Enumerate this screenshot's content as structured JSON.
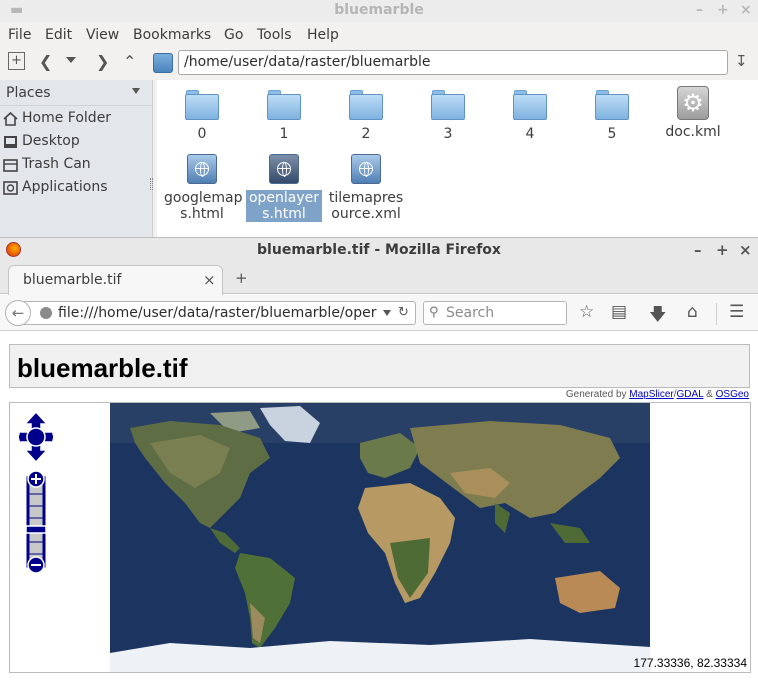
{
  "file_manager": {
    "title": "bluemarble",
    "menu": [
      "File",
      "Edit",
      "View",
      "Bookmarks",
      "Go",
      "Tools",
      "Help"
    ],
    "location": "/home/user/data/raster/bluemarble",
    "sidebar": {
      "header": "Places",
      "items": [
        {
          "label": "Home Folder",
          "icon": "home-icon"
        },
        {
          "label": "Desktop",
          "icon": "desktop-icon"
        },
        {
          "label": "Trash Can",
          "icon": "trash-icon"
        },
        {
          "label": "Applications",
          "icon": "applications-icon"
        }
      ]
    },
    "files": [
      {
        "name": "0",
        "type": "folder"
      },
      {
        "name": "1",
        "type": "folder"
      },
      {
        "name": "2",
        "type": "folder"
      },
      {
        "name": "3",
        "type": "folder"
      },
      {
        "name": "4",
        "type": "folder"
      },
      {
        "name": "5",
        "type": "folder"
      },
      {
        "name": "doc.kml",
        "type": "kml"
      },
      {
        "name": "googlemaps.html",
        "line1": "googlemap",
        "line2": "s.html",
        "type": "html"
      },
      {
        "name": "openlayers.html",
        "line1": "openlayer",
        "line2": "s.html",
        "type": "html",
        "selected": true
      },
      {
        "name": "tilemapresource.xml",
        "line1": "tilemapres",
        "line2": "ource.xml",
        "type": "xml"
      }
    ]
  },
  "firefox": {
    "title": "bluemarble.tif - Mozilla Firefox",
    "tab_title": "bluemarble.tif",
    "new_tab": "+",
    "url": "file:///home/user/data/raster/bluemarble/oper",
    "search_placeholder": "Search"
  },
  "page": {
    "heading": "bluemarble.tif",
    "credit_prefix": "Generated by ",
    "credit_link1": "MapSlicer",
    "credit_sep1": "/",
    "credit_link2": "GDAL",
    "credit_sep2": " & ",
    "credit_link3": "OSGeo",
    "coordinates": "177.33336, 82.33334"
  },
  "colors": {
    "map_control": "#00008b",
    "selection": "#7fa3c8",
    "ocean": "#1c3560"
  }
}
